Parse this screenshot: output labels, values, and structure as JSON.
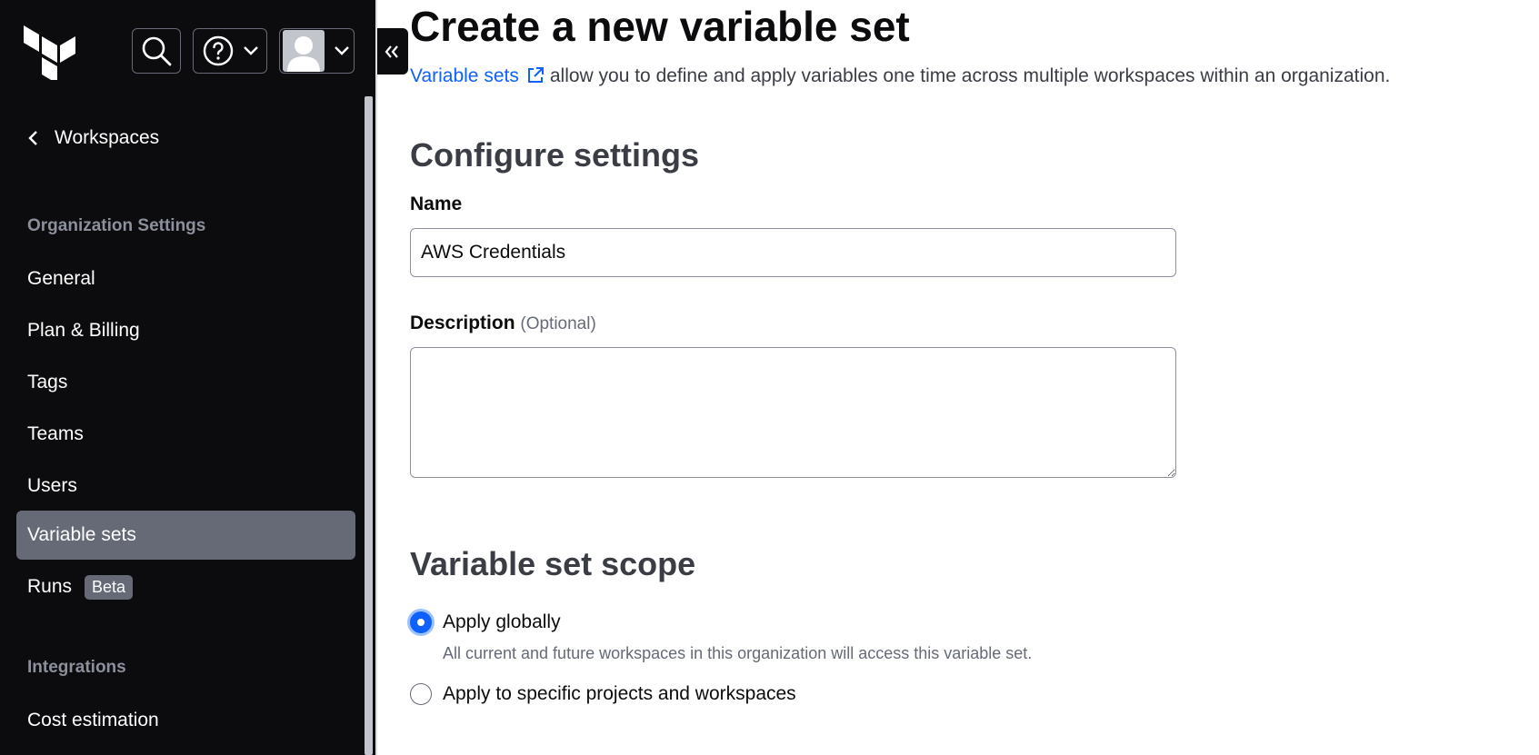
{
  "sidebar": {
    "back_label": "Workspaces",
    "sections": [
      {
        "title": "Organization Settings",
        "items": [
          {
            "label": "General",
            "active": false
          },
          {
            "label": "Plan & Billing",
            "active": false
          },
          {
            "label": "Tags",
            "active": false
          },
          {
            "label": "Teams",
            "active": false
          },
          {
            "label": "Users",
            "active": false
          },
          {
            "label": "Variable sets",
            "active": true
          },
          {
            "label": "Runs",
            "active": false,
            "badge": "Beta"
          }
        ]
      },
      {
        "title": "Integrations",
        "items": [
          {
            "label": "Cost estimation",
            "active": false
          }
        ]
      }
    ]
  },
  "header": {
    "icons": [
      "terraform-logo",
      "search-icon",
      "help-icon",
      "chevron-down-icon",
      "avatar",
      "collapse-icon"
    ]
  },
  "main": {
    "title": "Create a new variable set",
    "intro": {
      "link_text": "Variable sets",
      "text": "allow you to define and apply variables one time across multiple workspaces within an organization."
    },
    "configure": {
      "heading": "Configure settings",
      "name_label": "Name",
      "name_value": "AWS Credentials",
      "description_label": "Description",
      "description_optional": "(Optional)",
      "description_value": ""
    },
    "scope": {
      "heading": "Variable set scope",
      "options": [
        {
          "label": "Apply globally",
          "checked": true,
          "helper": "All current and future workspaces in this organization will access this variable set."
        },
        {
          "label": "Apply to specific projects and workspaces",
          "checked": false
        }
      ]
    }
  },
  "colors": {
    "sidebar_bg": "#0c0c0e",
    "active_item_bg": "#656a76",
    "link": "#1060ff",
    "radio_checked": "#1060ff"
  }
}
